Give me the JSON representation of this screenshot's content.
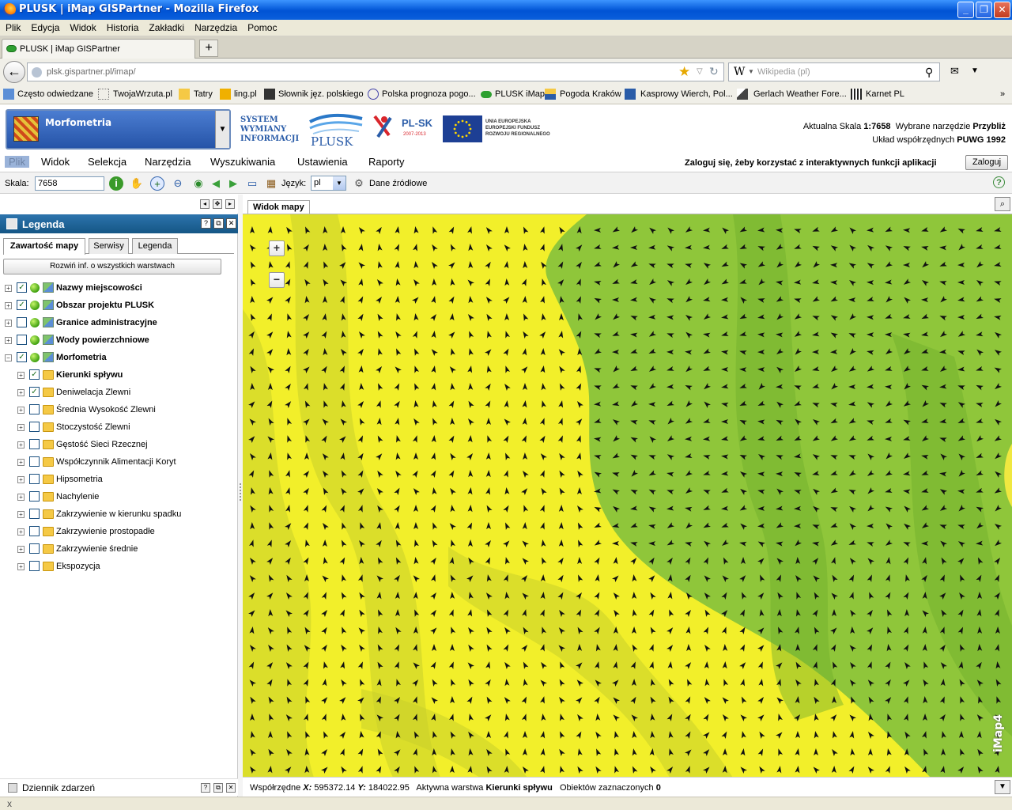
{
  "window": {
    "title": "PLUSK | iMap GISPartner - Mozilla Firefox",
    "buttons": {
      "minimize": "_",
      "maximize": "❐",
      "close": "✕"
    }
  },
  "browser_menu": [
    "Plik",
    "Edycja",
    "Widok",
    "Historia",
    "Zakładki",
    "Narzędzia",
    "Pomoc"
  ],
  "tab": {
    "label": "PLUSK | iMap GISPartner",
    "new_tab": "+"
  },
  "nav": {
    "url": "plsk.gispartner.pl/imap/",
    "search_placeholder": "Wikipedia (pl)",
    "search_engine": "W"
  },
  "bookmarks": [
    {
      "label": "Często odwiedzane",
      "icon": "bookmark-folder-icon"
    },
    {
      "label": "TwojaWrzuta.pl",
      "icon": "page-icon"
    },
    {
      "label": "Tatry",
      "icon": "folder-icon"
    },
    {
      "label": "ling.pl",
      "icon": "ling-icon"
    },
    {
      "label": "Słownik jęz. polskiego",
      "icon": "pwn-icon"
    },
    {
      "label": "Polska prognoza pogo...",
      "icon": "weather-icon"
    },
    {
      "label": "PLUSK iMap",
      "icon": "plusk-icon"
    },
    {
      "label": "Pogoda Kraków",
      "icon": "weather-icon"
    },
    {
      "label": "Kasprowy Wierch, Pol...",
      "icon": "webcam-icon"
    },
    {
      "label": "Gerlach Weather Fore...",
      "icon": "mountain-icon"
    },
    {
      "label": "Karnet PL",
      "icon": "barcode-icon"
    }
  ],
  "app_header": {
    "profile": "Morfometria",
    "logo_system": [
      "SYSTEM",
      "WYMIANY",
      "INFORMACJI"
    ],
    "logo_plusk": "PLUSK",
    "logo_plsk": "PL-SK",
    "logo_plsk_years": "2007-2013",
    "logo_ue": [
      "UNIA EUROPEJSKA",
      "EUROPEJSKI FUNDUSZ",
      "ROZWOJU REGIONALNEGO"
    ],
    "scale_label": "Aktualna Skala",
    "scale_value": "1:7658",
    "tool_label": "Wybrane narzędzie",
    "tool_value": "Przybliż",
    "crs_label": "Układ współrzędnych",
    "crs_value": "PUWG 1992"
  },
  "app_menu": {
    "items": [
      "Plik",
      "Widok",
      "Selekcja",
      "Narzędzia",
      "Wyszukiwania",
      "Ustawienia",
      "Raporty"
    ],
    "login_prompt": "Zaloguj się, żeby korzystać z interaktywnych funkcji aplikacji",
    "login_button": "Zaloguj"
  },
  "toolbar": {
    "scale_label": "Skala:",
    "scale_value": "7658",
    "language_label": "Język:",
    "language_value": "pl",
    "source_data": "Dane źródłowe"
  },
  "legend": {
    "title": "Legenda",
    "tabs": [
      "Zawartość mapy",
      "Serwisy",
      "Legenda"
    ],
    "expand_all": "Rozwiń inf. o wszystkich warstwach",
    "layers": [
      {
        "label": "Nazwy miejscowości",
        "checked": true,
        "level": 0,
        "expanded": false
      },
      {
        "label": "Obszar projektu PLUSK",
        "checked": true,
        "level": 0,
        "expanded": false
      },
      {
        "label": "Granice administracyjne",
        "checked": false,
        "level": 0,
        "expanded": false
      },
      {
        "label": "Wody powierzchniowe",
        "checked": false,
        "level": 0,
        "expanded": false
      },
      {
        "label": "Morfometria",
        "checked": true,
        "level": 0,
        "expanded": true
      },
      {
        "label": "Kierunki spływu",
        "checked": true,
        "level": 1,
        "bold": true
      },
      {
        "label": "Deniwelacja Zlewni",
        "checked": true,
        "level": 1
      },
      {
        "label": "Średnia Wysokość Zlewni",
        "checked": false,
        "level": 1
      },
      {
        "label": "Stoczystość Zlewni",
        "checked": false,
        "level": 1
      },
      {
        "label": "Gęstość Sieci Rzecznej",
        "checked": false,
        "level": 1
      },
      {
        "label": "Współczynnik Alimentacji Koryt",
        "checked": false,
        "level": 1
      },
      {
        "label": "Hipsometria",
        "checked": false,
        "level": 1
      },
      {
        "label": "Nachylenie",
        "checked": false,
        "level": 1
      },
      {
        "label": "Zakrzywienie w kierunku spadku",
        "checked": false,
        "level": 1
      },
      {
        "label": "Zakrzywienie prostopadłe",
        "checked": false,
        "level": 1
      },
      {
        "label": "Zakrzywienie średnie",
        "checked": false,
        "level": 1
      },
      {
        "label": "Ekspozycja",
        "checked": false,
        "level": 1
      }
    ],
    "events_title": "Dziennik zdarzeń"
  },
  "map": {
    "tab_label": "Widok mapy",
    "logo": "iMap4",
    "zoom_in": "+",
    "zoom_out": "−",
    "colors": {
      "yellow": "#f2ef2a",
      "green": "#8fc63a",
      "shade": "#c9cf2a"
    }
  },
  "status": {
    "coords_label": "Współrzędne",
    "x_label": "X:",
    "x_value": "595372.14",
    "y_label": "Y:",
    "y_value": "184022.95",
    "active_layer_label": "Aktywna warstwa",
    "active_layer_value": "Kierunki spływu",
    "selected_label": "Obiektów zaznaczonych",
    "selected_value": "0"
  },
  "firefox_status": {
    "close": "x"
  }
}
